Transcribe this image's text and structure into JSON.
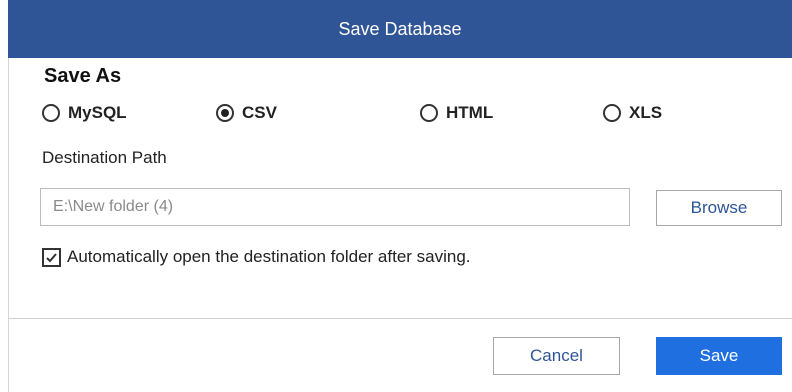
{
  "dialog": {
    "title": "Save Database",
    "save_as_label": "Save As",
    "options": [
      {
        "label": "MySQL",
        "selected": false
      },
      {
        "label": "CSV",
        "selected": true
      },
      {
        "label": "HTML",
        "selected": false
      },
      {
        "label": "XLS",
        "selected": false
      }
    ],
    "destination_label": "Destination Path",
    "destination_value": "E:\\New folder (4)",
    "browse_label": "Browse",
    "auto_open_label": "Automatically open the destination folder after saving.",
    "auto_open_checked": true,
    "cancel_label": "Cancel",
    "save_label": "Save"
  },
  "colors": {
    "title_bar": "#2f5597",
    "accent": "#1f6fe0",
    "link_text": "#2f5597"
  },
  "icons": {
    "radio": "radio-circle",
    "checkbox": "checkmark-icon"
  }
}
